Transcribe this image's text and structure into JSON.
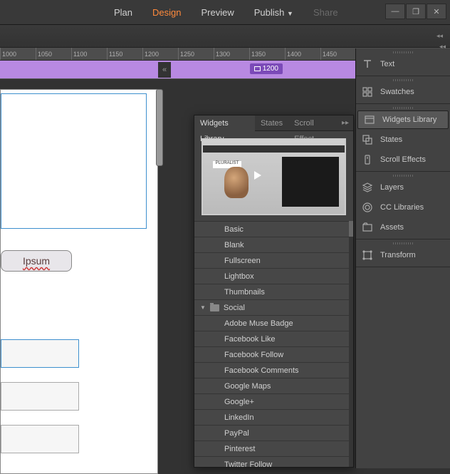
{
  "menu": {
    "items": [
      "Plan",
      "Design",
      "Preview",
      "Publish",
      "Share"
    ],
    "active_index": 1,
    "disabled_index": 4,
    "dropdown_index": 3
  },
  "ruler": {
    "values": [
      "1000",
      "1050",
      "1100",
      "1150",
      "1200",
      "1250",
      "1300",
      "1350",
      "1400",
      "1450"
    ]
  },
  "breakpoint": {
    "label": "1200"
  },
  "canvas": {
    "text_box": "Ipsum"
  },
  "widgets_panel": {
    "tabs": [
      "Widgets Library",
      "States",
      "Scroll Effect"
    ],
    "active_tab": 0,
    "preview_label": "PLURALIST",
    "list": [
      {
        "type": "item",
        "label": "Basic"
      },
      {
        "type": "item",
        "label": "Blank"
      },
      {
        "type": "item",
        "label": "Fullscreen"
      },
      {
        "type": "item",
        "label": "Lightbox"
      },
      {
        "type": "item",
        "label": "Thumbnails"
      },
      {
        "type": "category",
        "label": "Social"
      },
      {
        "type": "item",
        "label": "Adobe Muse Badge"
      },
      {
        "type": "item",
        "label": "Facebook Like"
      },
      {
        "type": "item",
        "label": "Facebook Follow"
      },
      {
        "type": "item",
        "label": "Facebook Comments"
      },
      {
        "type": "item",
        "label": "Google Maps"
      },
      {
        "type": "item",
        "label": "Google+"
      },
      {
        "type": "item",
        "label": "LinkedIn"
      },
      {
        "type": "item",
        "label": "PayPal"
      },
      {
        "type": "item",
        "label": "Pinterest"
      },
      {
        "type": "item",
        "label": "Twitter Follow"
      }
    ]
  },
  "right_dock": {
    "groups": [
      {
        "rows": [
          {
            "icon": "text",
            "label": "Text"
          }
        ]
      },
      {
        "rows": [
          {
            "icon": "swatches",
            "label": "Swatches"
          }
        ]
      },
      {
        "rows": [
          {
            "icon": "widgets",
            "label": "Widgets Library",
            "active": true
          },
          {
            "icon": "states",
            "label": "States"
          },
          {
            "icon": "scrollfx",
            "label": "Scroll Effects"
          }
        ]
      },
      {
        "rows": [
          {
            "icon": "layers",
            "label": "Layers"
          },
          {
            "icon": "cc",
            "label": "CC Libraries"
          },
          {
            "icon": "assets",
            "label": "Assets"
          }
        ]
      },
      {
        "rows": [
          {
            "icon": "transform",
            "label": "Transform"
          }
        ]
      }
    ]
  }
}
